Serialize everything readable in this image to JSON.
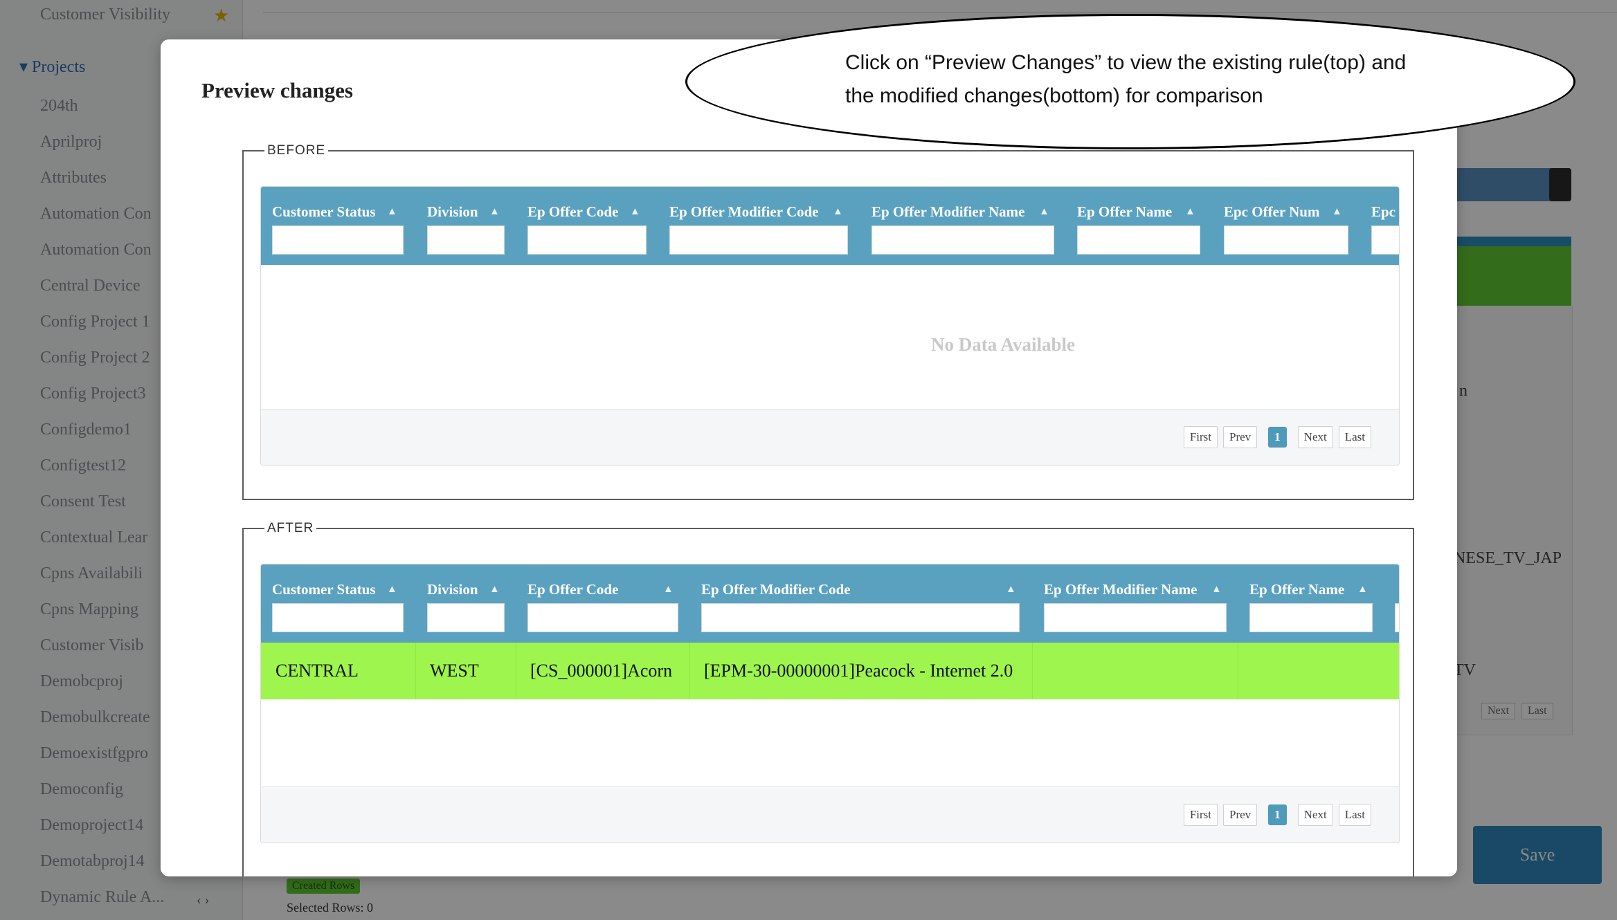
{
  "background": {
    "sidebar": {
      "top_item": "Customer Visibility",
      "section_label": "Projects",
      "items": [
        "204th",
        "Aprilproj",
        "Attributes",
        "Automation Con",
        "Automation Con",
        "Central Device",
        "Config Project 1",
        "Config Project 2",
        "Config Project3",
        "Configdemo1",
        "Configtest12",
        "Consent Test",
        "Contextual Lear",
        "Cpns Availabili",
        "Cpns Mapping",
        "Customer Visib",
        "Demobcproj",
        "Demobulkcreate",
        "Demoexistfgpro",
        "Democonfig",
        "Demoproject14",
        "Demotabproj14",
        "Dynamic Rule A..."
      ]
    },
    "right_panel": {
      "fragment_1": "n",
      "fragment_2": "NESE_TV_JAP",
      "fragment_3": "TV",
      "pager_next": "Next",
      "pager_last": "Last"
    },
    "save_label": "Save",
    "created_rows_label": "Created Rows",
    "selected_rows_label": "Selected Rows: 0"
  },
  "modal": {
    "title": "Preview changes"
  },
  "callout": {
    "line1": "Click on “Preview Changes” to view the existing rule(top) and",
    "line2": "the modified changes(bottom) for comparison"
  },
  "before": {
    "legend": "BEFORE",
    "columns": [
      "Customer Status",
      "Division",
      "Ep Offer Code",
      "Ep Offer Modifier Code",
      "Ep Offer Modifier Name",
      "Ep Offer Name",
      "Epc Offer Num",
      "Epc"
    ],
    "empty_message": "No Data Available",
    "pager": {
      "first": "First",
      "prev": "Prev",
      "page": "1",
      "next": "Next",
      "last": "Last"
    }
  },
  "after": {
    "legend": "AFTER",
    "columns": [
      "Customer Status",
      "Division",
      "Ep Offer Code",
      "Ep Offer Modifier Code",
      "Ep Offer Modifier Name",
      "Ep Offer Name"
    ],
    "rows": [
      {
        "customer_status": "CENTRAL",
        "division": "WEST",
        "ep_offer_code": "[CS_000001]Acorn",
        "ep_offer_modifier_code": "[EPM-30-00000001]Peacock - Internet 2.0",
        "ep_offer_modifier_name": "",
        "ep_offer_name": ""
      }
    ],
    "pager": {
      "first": "First",
      "prev": "Prev",
      "page": "1",
      "next": "Next",
      "last": "Last"
    }
  },
  "colors": {
    "header_blue": "#5aa1c0",
    "row_green": "#9df54d",
    "active_page": "#4e9ab9",
    "overlay": "rgba(0,0,0,0.46)"
  }
}
